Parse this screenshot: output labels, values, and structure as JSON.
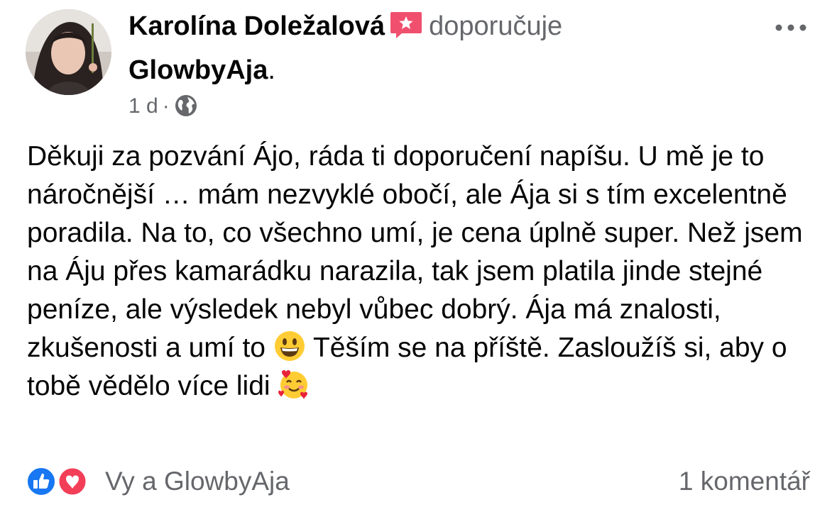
{
  "post": {
    "author": "Karolína Doležalová",
    "action": "doporučuje",
    "page": "GlowbyAja",
    "page_suffix": ".",
    "time": "1 d",
    "separator": "·",
    "privacy_icon": "globe-icon",
    "more_icon": "more-options-icon",
    "badge_icon": "recommendation-star-icon",
    "badge_color": "#f0506e",
    "text_segments": [
      "Děkuji za pozvání Ájo, ráda ti doporučení napíšu. U mě je to náročnější … mám nezvyklé obočí, ale Ája si s tím excelentně poradila. Na to, co všechno umí, je cena úplně super. Než jsem na Áju přes kamarádku narazila, tak jsem platila jinde stejné peníze, ale výsledek nebyl vůbec dobrý. Ája má znalosti, zkušenosti a umí to ",
      " Těším se na příště. Zasloužíš si, aby o tobě vědělo více lidi "
    ],
    "emoji_1": "grinning-face-emoji",
    "emoji_2": "smiling-face-with-hearts-emoji"
  },
  "footer": {
    "reaction_icons": [
      "like-icon",
      "love-icon"
    ],
    "reaction_colors": {
      "like": "#1877f2",
      "love": "#f33e58"
    },
    "reactions_text": "Vy a GlowbyAja",
    "comments_text": "1 komentář"
  }
}
